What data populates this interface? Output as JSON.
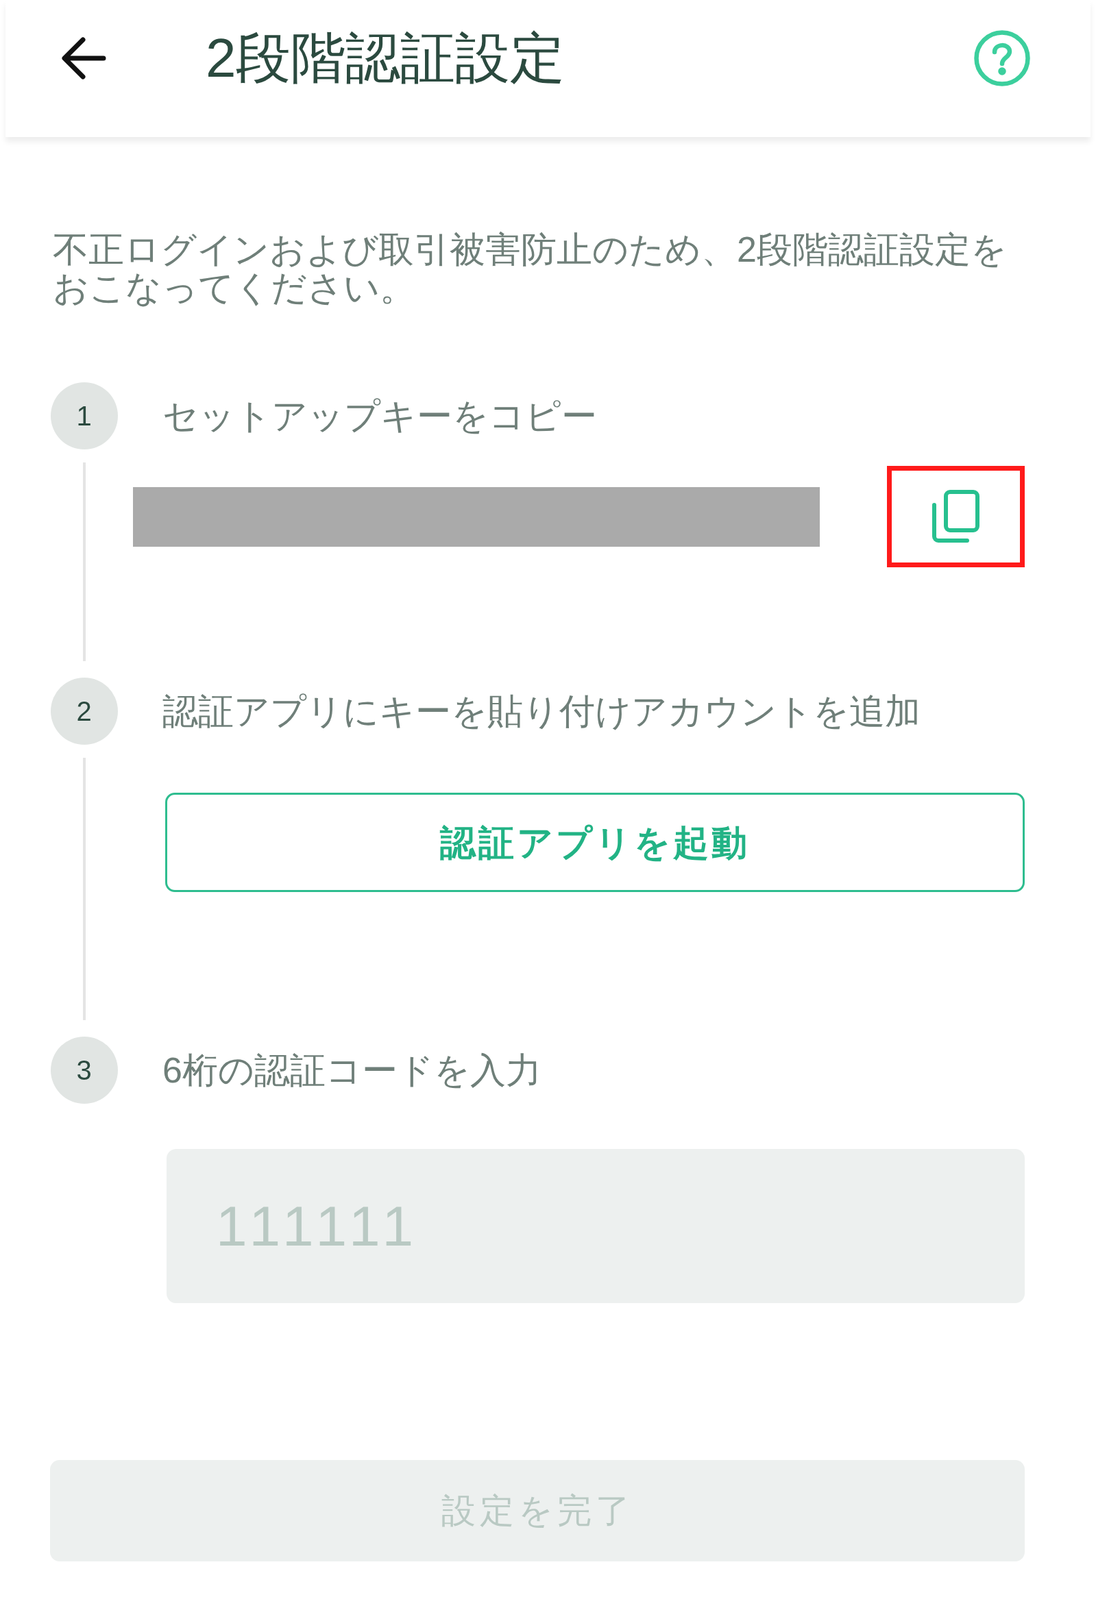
{
  "header": {
    "title": "2段階認証設定"
  },
  "intro": "不正ログインおよび取引被害防止のため、2段階認証設定をおこなってください。",
  "steps": [
    {
      "kind": "copy",
      "number": "1",
      "label": "セットアップキーをコピー",
      "highlighted": true
    },
    {
      "kind": "button",
      "number": "2",
      "label": "認証アプリにキーを貼り付けアカウントを追加",
      "button": "認証アプリを起動"
    },
    {
      "kind": "input",
      "number": "3",
      "label": "6桁の認証コードを入力",
      "placeholder": "111111"
    }
  ],
  "submit": {
    "label": "設定を完了",
    "disabled": true
  }
}
